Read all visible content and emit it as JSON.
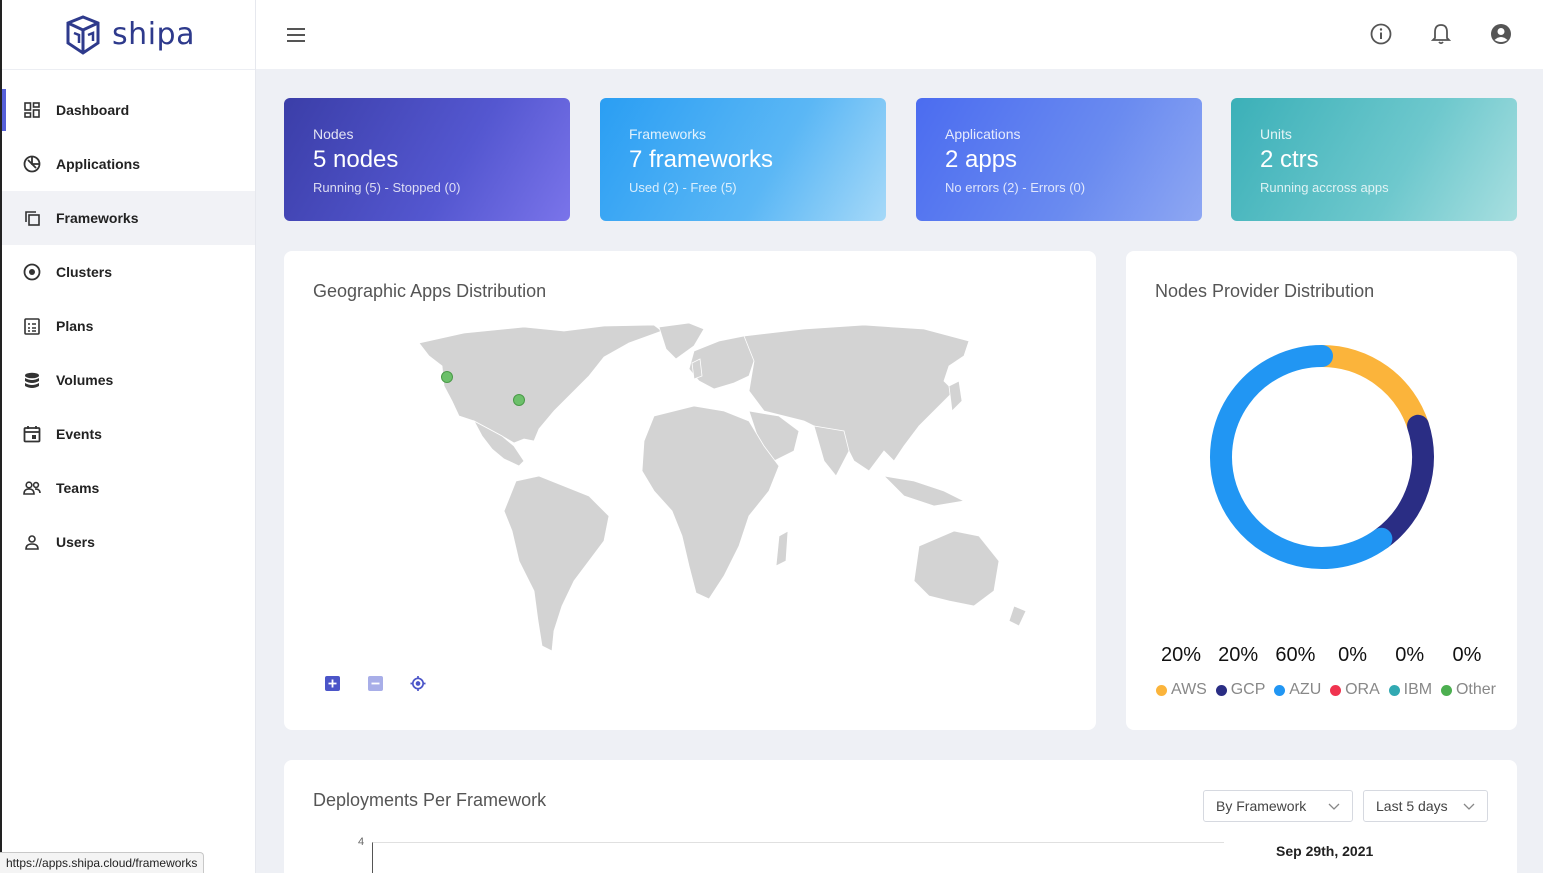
{
  "brand": {
    "name": "shipa"
  },
  "sidebar": {
    "items": [
      {
        "label": "Dashboard",
        "icon": "dashboard-icon"
      },
      {
        "label": "Applications",
        "icon": "applications-icon"
      },
      {
        "label": "Frameworks",
        "icon": "frameworks-icon"
      },
      {
        "label": "Clusters",
        "icon": "clusters-icon"
      },
      {
        "label": "Plans",
        "icon": "plans-icon"
      },
      {
        "label": "Volumes",
        "icon": "volumes-icon"
      },
      {
        "label": "Events",
        "icon": "events-icon"
      },
      {
        "label": "Teams",
        "icon": "teams-icon"
      },
      {
        "label": "Users",
        "icon": "users-icon"
      }
    ]
  },
  "stats": [
    {
      "label": "Nodes",
      "value": "5 nodes",
      "sub": "Running (5) - Stopped (0)"
    },
    {
      "label": "Frameworks",
      "value": "7 frameworks",
      "sub": "Used (2) - Free (5)"
    },
    {
      "label": "Applications",
      "value": "2 apps",
      "sub": "No errors (2) - Errors (0)"
    },
    {
      "label": "Units",
      "value": "2 ctrs",
      "sub": "Running accross apps"
    }
  ],
  "map": {
    "title": "Geographic Apps Distribution"
  },
  "donut": {
    "title": "Nodes Provider Distribution",
    "providers": [
      {
        "name": "AWS",
        "pct": "20%",
        "value": 20,
        "color": "#fbb43b"
      },
      {
        "name": "GCP",
        "pct": "20%",
        "value": 20,
        "color": "#2a2d84"
      },
      {
        "name": "AZU",
        "pct": "60%",
        "value": 60,
        "color": "#2196f3"
      },
      {
        "name": "ORA",
        "pct": "0%",
        "value": 0,
        "color": "#f0334f"
      },
      {
        "name": "IBM",
        "pct": "0%",
        "value": 0,
        "color": "#31a9b2"
      },
      {
        "name": "Other",
        "pct": "0%",
        "value": 0,
        "color": "#4caf50"
      }
    ]
  },
  "deployments": {
    "title": "Deployments Per Framework",
    "group_by": "By Framework",
    "range": "Last 5 days",
    "y_max_tick": "4",
    "tooltip_date": "Sep 29th, 2021"
  },
  "status_url": "https://apps.shipa.cloud/frameworks"
}
